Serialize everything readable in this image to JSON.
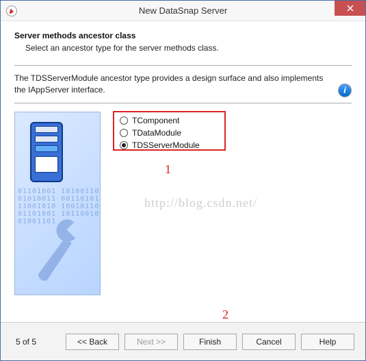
{
  "window": {
    "title": "New DataSnap Server"
  },
  "header": {
    "title": "Server methods ancestor class",
    "subtitle": "Select an ancestor type for the server methods class."
  },
  "description": "The TDSServerModule ancestor type provides a design surface and also implements the IAppServer interface.",
  "options": [
    {
      "label": "TComponent",
      "checked": false
    },
    {
      "label": "TDataModule",
      "checked": false
    },
    {
      "label": "TDSServerModule",
      "checked": true
    }
  ],
  "annotations": {
    "marker1": "1",
    "marker2": "2"
  },
  "watermark": "http://blog.csdn.net/",
  "footer": {
    "step": "5 of 5",
    "back": "<< Back",
    "next": "Next >>",
    "finish": "Finish",
    "cancel": "Cancel",
    "help": "Help"
  }
}
